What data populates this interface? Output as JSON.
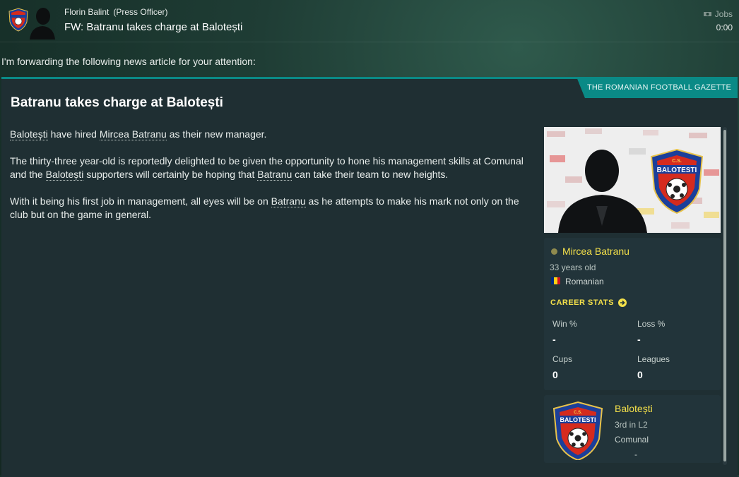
{
  "header": {
    "sender_name": "Florin Balint",
    "sender_role": "(Press Officer)",
    "subject": "FW: Batranu takes charge at Balotești",
    "jobs_label": "Jobs",
    "time": "0:00"
  },
  "forward_text": "I'm forwarding the following news article for your attention:",
  "article": {
    "source": "THE ROMANIAN FOOTBALL GAZETTE",
    "headline": "Batranu takes charge at Balotești",
    "p1": {
      "club": "Balotești",
      "t1": " have hired ",
      "manager": "Mircea Batranu",
      "t2": " as their new manager."
    },
    "p2": {
      "t1": "The thirty-three year-old is reportedly delighted to be given the opportunity to hone his management skills at Comunal and the ",
      "club": "Balotești",
      "t2": " supporters will certainly be hoping that ",
      "manager": "Batranu",
      "t3": " can take their team to new heights."
    },
    "p3": {
      "t1": "With it being his first job in management, all eyes will be on ",
      "manager": "Batranu",
      "t2": " as he attempts to make his mark not only on the club but on the game in general."
    }
  },
  "player": {
    "name": "Mircea Batranu",
    "age": "33 years old",
    "nationality": "Romanian",
    "flag_colors": [
      "#002b7f",
      "#fcd116",
      "#ce1126"
    ],
    "career_stats_label": "CAREER STATS",
    "stats": {
      "win_label": "Win %",
      "win_value": "-",
      "loss_label": "Loss %",
      "loss_value": "-",
      "cups_label": "Cups",
      "cups_value": "0",
      "leagues_label": "Leagues",
      "leagues_value": "0"
    }
  },
  "club": {
    "name": "Balotești",
    "position": "3rd in L2",
    "stadium": "Comunal",
    "extra": "-",
    "crest_text": "BALOTESTI",
    "crest_top_text": "C.S."
  },
  "colors": {
    "accent_teal": "#0a8a86",
    "highlight_yellow": "#f4e04a",
    "crest_red": "#d52b1e",
    "crest_blue": "#1b3f9a"
  }
}
